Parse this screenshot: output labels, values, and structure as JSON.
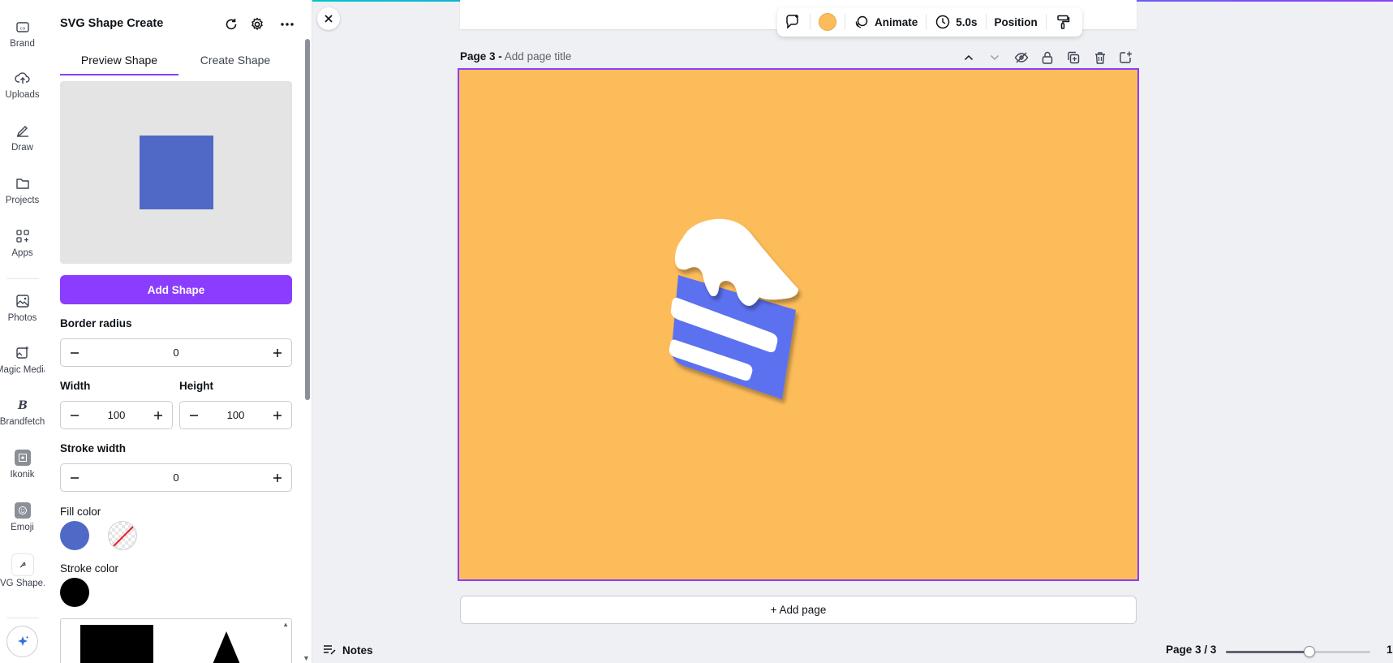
{
  "rail": {
    "items": [
      {
        "label": "Brand"
      },
      {
        "label": "Uploads"
      },
      {
        "label": "Draw"
      },
      {
        "label": "Projects"
      },
      {
        "label": "Apps"
      },
      {
        "label": "Photos"
      },
      {
        "label": "Magic Media"
      },
      {
        "label": "Brandfetch"
      },
      {
        "label": "Ikonik"
      },
      {
        "label": "Emoji"
      },
      {
        "label": "SVG Shape..."
      }
    ]
  },
  "panel": {
    "title": "SVG Shape Create",
    "tabs": [
      {
        "label": "Preview Shape",
        "active": true
      },
      {
        "label": "Create Shape",
        "active": false
      }
    ],
    "preview_color": "#5069c7",
    "add_button": "Add Shape",
    "border_radius": {
      "label": "Border radius",
      "value": "0"
    },
    "width": {
      "label": "Width",
      "value": "100"
    },
    "height": {
      "label": "Height",
      "value": "100"
    },
    "stroke_width": {
      "label": "Stroke width",
      "value": "0"
    },
    "fill_color": {
      "label": "Fill color",
      "value": "#5069c7"
    },
    "stroke_color": {
      "label": "Stroke color",
      "value": "#000000"
    }
  },
  "toolbar": {
    "color": "#fdbc5a",
    "animate": "Animate",
    "duration": "5.0s",
    "position": "Position"
  },
  "page": {
    "number": "Page 3 -",
    "title_placeholder": "Add page title",
    "background": "#fdbc5a"
  },
  "add_page": "+ Add page",
  "footer": {
    "notes": "Notes",
    "page_count": "Page 3 / 3",
    "zoom_fraction": 0.58,
    "zoom_value": "1"
  },
  "colors": {
    "accent": "#8b3dff",
    "cake_body": "#5b71f0",
    "canvas_bg": "#fdbc5a"
  }
}
